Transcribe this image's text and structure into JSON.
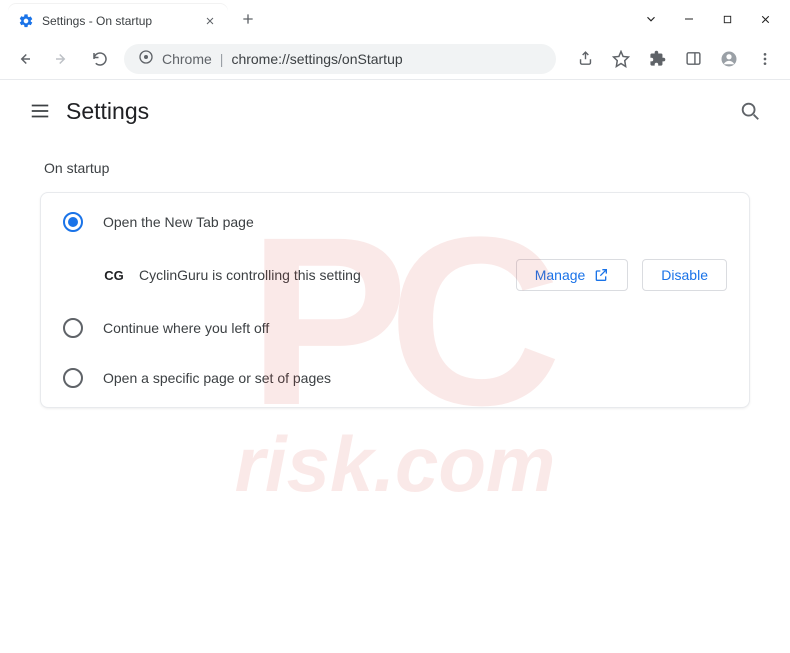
{
  "tab": {
    "title": "Settings - On startup"
  },
  "omnibox": {
    "prefix": "Chrome",
    "url": "chrome://settings/onStartup"
  },
  "app": {
    "title": "Settings"
  },
  "section": {
    "title": "On startup"
  },
  "options": {
    "open_new_tab": "Open the New Tab page",
    "continue": "Continue where you left off",
    "specific": "Open a specific page or set of pages"
  },
  "extension": {
    "icon_text": "CG",
    "message": "CyclinGuru is controlling this setting",
    "manage": "Manage",
    "disable": "Disable"
  },
  "watermark": {
    "logo_text": "PC",
    "subtext": "risk.com"
  }
}
